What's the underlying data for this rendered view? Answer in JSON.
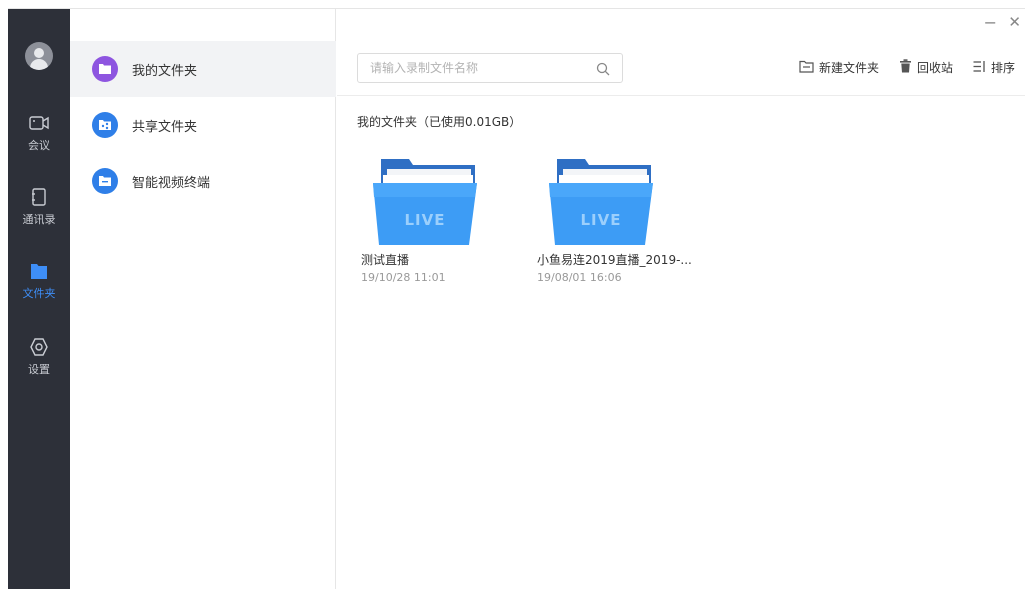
{
  "window": {
    "minimize": "−",
    "close": "✕"
  },
  "rail": {
    "items": [
      {
        "label": "会议",
        "icon": "camera-icon"
      },
      {
        "label": "通讯录",
        "icon": "contacts-icon"
      },
      {
        "label": "文件夹",
        "icon": "folder-icon",
        "active": true
      },
      {
        "label": "设置",
        "icon": "settings-icon"
      }
    ],
    "accent": "#3e8ef7"
  },
  "folder_panel": {
    "items": [
      {
        "label": "我的文件夹",
        "icon": "my-folder-icon",
        "color": "#8e55e0",
        "active": true
      },
      {
        "label": "共享文件夹",
        "icon": "shared-folder-icon",
        "color": "#2f7fe8"
      },
      {
        "label": "智能视频终端",
        "icon": "terminal-folder-icon",
        "color": "#2f7fe8"
      }
    ]
  },
  "search": {
    "placeholder": "请输入录制文件名称",
    "value": ""
  },
  "toolbar": {
    "new_folder": "新建文件夹",
    "recycle": "回收站",
    "sort": "排序"
  },
  "section_title": "我的文件夹（已使用0.01GB）",
  "files": [
    {
      "name": "测试直播",
      "date": "19/10/28 11:01",
      "badge": "LIVE"
    },
    {
      "name": "小鱼易连2019直播_2019-...",
      "date": "19/08/01 16:06",
      "badge": "LIVE"
    }
  ]
}
